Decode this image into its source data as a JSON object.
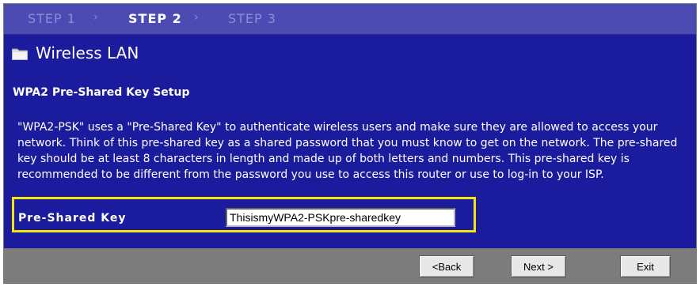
{
  "steps": [
    {
      "label": "STEP 1",
      "state": "inactive"
    },
    {
      "label": "STEP 2",
      "state": "active"
    },
    {
      "label": "STEP 3",
      "state": "inactive"
    }
  ],
  "step_arrow": "›",
  "window": {
    "title": "Wireless LAN",
    "icon": "folder-icon"
  },
  "section": {
    "title": "WPA2 Pre-Shared Key Setup",
    "description": "\"WPA2-PSK\" uses a \"Pre-Shared Key\" to authenticate wireless users and make sure they are allowed to access your network. Think of this pre-shared key as a shared password that you must know to get on the network. The pre-shared key should be at least 8 characters in length and made up of both letters and numbers. This pre-shared key is recommended to be different from the password you use to access this router or use to log-in to your ISP."
  },
  "psk": {
    "label": "Pre-Shared Key",
    "value": "ThisismyWPA2-PSKpre-sharedkey",
    "highlight_color": "#f5e60a"
  },
  "buttons": {
    "back": "<Back",
    "next": "Next >",
    "exit": "Exit"
  },
  "colors": {
    "background": "#1b1b9e",
    "step_bar": "#4b4bb3",
    "footer": "#7c7c7c"
  }
}
